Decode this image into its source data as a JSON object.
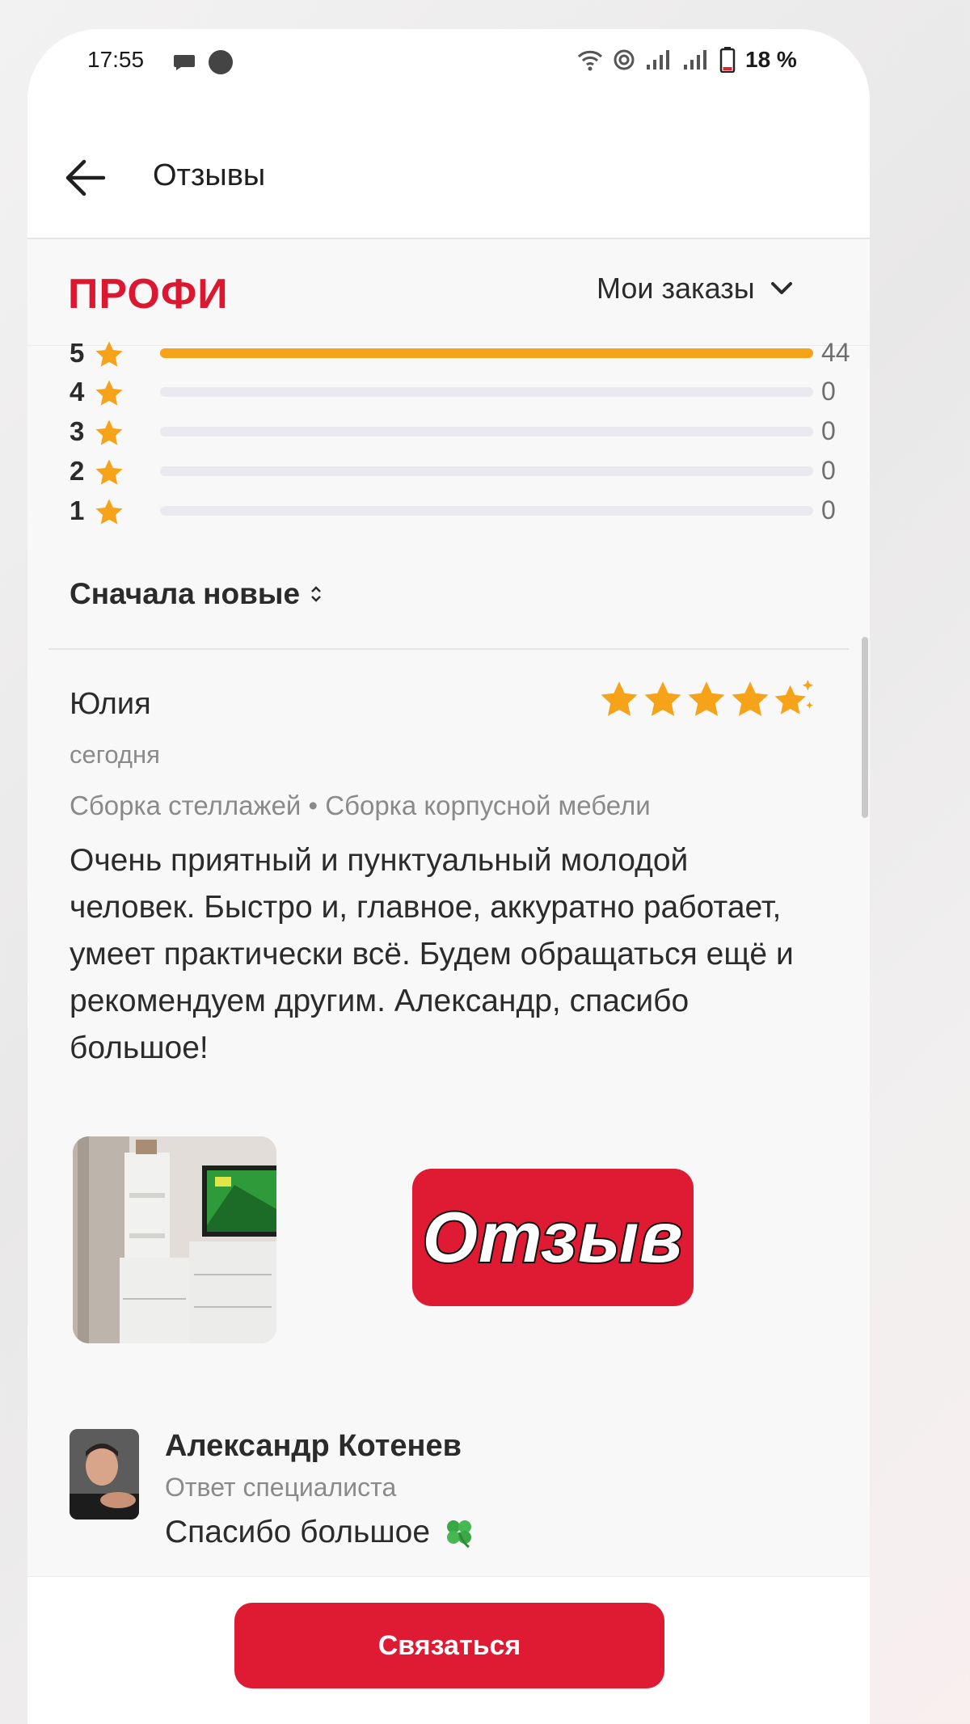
{
  "status_bar": {
    "time": "17:55",
    "battery": "18 %",
    "icons": [
      "message-icon",
      "dot-icon",
      "wifi-icon",
      "hotspot-icon",
      "signal-icon",
      "signal-icon",
      "battery-icon"
    ]
  },
  "topbar": {
    "title": "Отзывы",
    "back_icon": "back-arrow-icon"
  },
  "header": {
    "logo": "ПРОФИ",
    "orders_label": "Мои заказы",
    "accent_color": "#dc1830"
  },
  "ratings": [
    {
      "stars": "5",
      "count": "44",
      "fill": 1.0
    },
    {
      "stars": "4",
      "count": "0",
      "fill": 0
    },
    {
      "stars": "3",
      "count": "0",
      "fill": 0
    },
    {
      "stars": "2",
      "count": "0",
      "fill": 0
    },
    {
      "stars": "1",
      "count": "0",
      "fill": 0
    }
  ],
  "sort": {
    "label": "Сначала новые"
  },
  "review": {
    "author": "Юлия",
    "rating": 5,
    "date": "сегодня",
    "tags": "Сборка стеллажей • Сборка корпусной мебели",
    "text": "Очень приятный и пунктуальный молодой человек. Быстро и, главное, аккуратно работает, умеет практически всё. Будем обращаться ещё и рекомендуем другим. Александр, спасибо большое!"
  },
  "stamp": {
    "text": "Отзыв"
  },
  "reply": {
    "name": "Александр Котенев",
    "role": "Ответ специалиста",
    "text": "Спасибо большое"
  },
  "action": {
    "contact_label": "Связаться"
  }
}
